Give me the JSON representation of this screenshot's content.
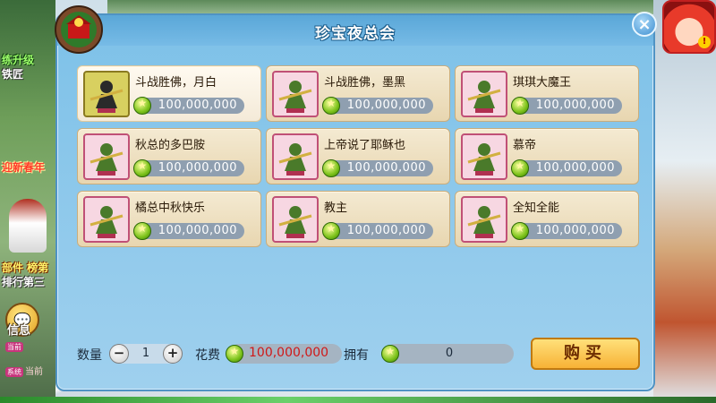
{
  "dialog": {
    "title": "珍宝夜总会",
    "close_icon": "×"
  },
  "items": [
    {
      "name": "斗战胜佛，月白",
      "price": "100,000,000",
      "selected": true,
      "thumb": "gold"
    },
    {
      "name": "斗战胜佛，墨黑",
      "price": "100,000,000",
      "selected": false,
      "thumb": "pink"
    },
    {
      "name": "琪琪大魔王",
      "price": "100,000,000",
      "selected": false,
      "thumb": "pink"
    },
    {
      "name": "秋总的多巴胺",
      "price": "100,000,000",
      "selected": false,
      "thumb": "pink"
    },
    {
      "name": "上帝说了耶稣也",
      "price": "100,000,000",
      "selected": false,
      "thumb": "pink"
    },
    {
      "name": "慕帝",
      "price": "100,000,000",
      "selected": false,
      "thumb": "pink"
    },
    {
      "name": "橘总中秋快乐",
      "price": "100,000,000",
      "selected": false,
      "thumb": "pink"
    },
    {
      "name": "教主",
      "price": "100,000,000",
      "selected": false,
      "thumb": "pink"
    },
    {
      "name": "全知全能",
      "price": "100,000,000",
      "selected": false,
      "thumb": "pink"
    }
  ],
  "footer": {
    "quantity_label": "数量",
    "quantity_value": "1",
    "cost_label": "花费",
    "cost_value": "100,000,000",
    "owned_label": "拥有",
    "owned_value": "0",
    "buy_label": "购买"
  },
  "side": {
    "upgrade_text": "练升级",
    "smith_text": "铁匠",
    "festival_text": "迎新春年",
    "rank_text": "部件 榜第",
    "rank_text2": "排行第三",
    "info_label": "信息",
    "chat1_tag": "当前",
    "chat1_text": "当前",
    "chat2_tag": "系统",
    "chat2_text": "当前"
  },
  "colors": {
    "dialog_bg": "#8cc7ea",
    "card_bg": "#efe1c2",
    "price_text": "#d01818",
    "buy_button": "#f7c14a"
  }
}
